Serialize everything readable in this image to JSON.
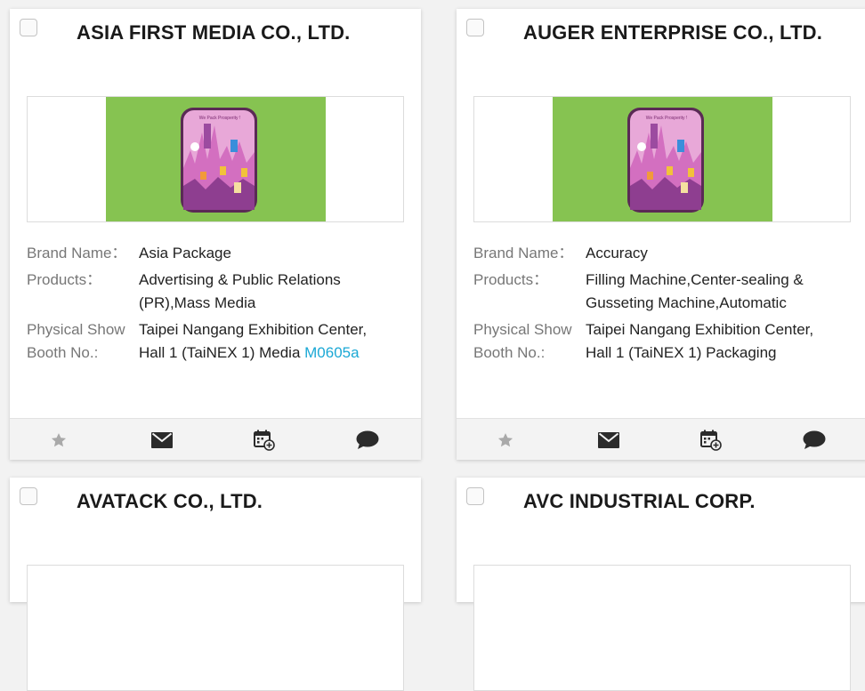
{
  "labels": {
    "brand_name": "Brand Name：",
    "products": "Products：",
    "booth_line1": "Physical Show",
    "booth_line2": "Booth No.:"
  },
  "image": {
    "caption": "We Pack Prosperity !",
    "bg_color": "#86c351"
  },
  "cards": [
    {
      "title": "ASIA FIRST MEDIA CO., LTD.",
      "brand": "Asia Package",
      "products_line1": "Advertising & Public Relations",
      "products_line2": "(PR),Mass Media",
      "booth_line1": "Taipei Nangang Exhibition Center,",
      "booth_line2": "Hall 1 (TaiNEX 1) Media",
      "booth_code": "M0605a"
    },
    {
      "title": "AUGER ENTERPRISE CO., LTD.",
      "brand": "Accuracy",
      "products_line1": "Filling Machine,Center-sealing &",
      "products_line2": "Gusseting Machine,Automatic",
      "booth_line1": "Taipei Nangang Exhibition Center,",
      "booth_line2": "Hall 1 (TaiNEX 1) Packaging",
      "booth_code": ""
    },
    {
      "title": "AVATACK CO., LTD."
    },
    {
      "title": "AVC INDUSTRIAL CORP."
    }
  ],
  "actions": {
    "icons": [
      "star-icon",
      "mail-icon",
      "calendar-add-icon",
      "chat-icon"
    ],
    "colors": {
      "star": "#a9a9a9",
      "icon": "#2b2b2b",
      "link": "#1ba8d5"
    }
  }
}
